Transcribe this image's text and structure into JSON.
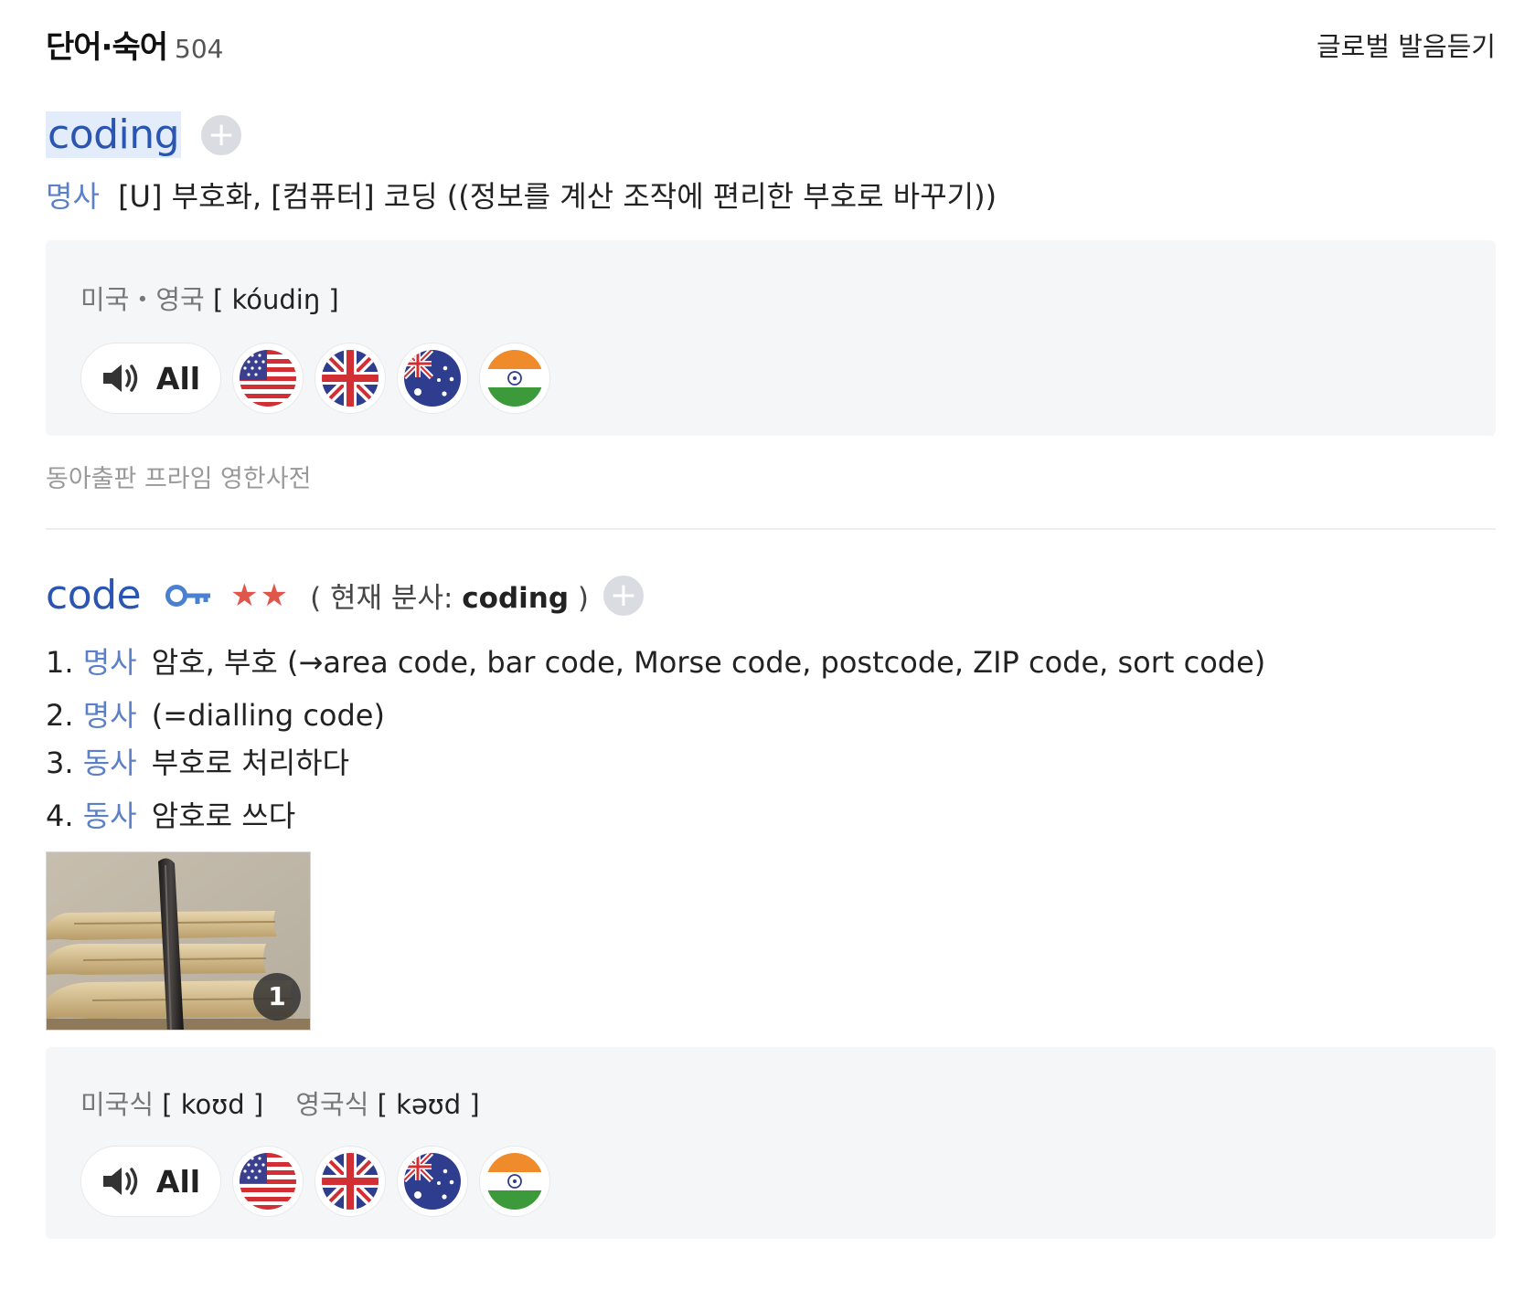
{
  "header": {
    "title": "단어·숙어",
    "count": "504",
    "global_link": "글로벌 발음듣기"
  },
  "entry1": {
    "headword": "coding",
    "pos": "명사",
    "definition": "[U] 부호화, [컴퓨터] 코딩 ((정보를 계산 조작에 편리한 부호로 바꾸기))",
    "pron_label": "미국・영국",
    "pron": "[ kóudiŋ ]",
    "all_label": "All",
    "source": "동아출판 프라임 영한사전"
  },
  "entry2": {
    "headword": "code",
    "stars": "★★",
    "participle_open": "( 현재 분사: ",
    "participle_word": "coding",
    "participle_close": " )",
    "meanings": [
      {
        "num": "1.",
        "pos": "명사",
        "text": "암호, 부호 (→area code, bar code, Morse code, postcode, ZIP code, sort code)"
      },
      {
        "num": "2.",
        "pos": "명사",
        "text": "(=dialling code)"
      },
      {
        "num": "3.",
        "pos": "동사",
        "text": "부호로 처리하다"
      },
      {
        "num": "4.",
        "pos": "동사",
        "text": "암호로 쓰다"
      }
    ],
    "image_count": "1",
    "pron_us_label": "미국식",
    "pron_us": "[ koʊd ]",
    "pron_uk_label": "영국식",
    "pron_uk": "[ kəʊd ]",
    "all_label": "All"
  },
  "icons": {
    "plus": "plus-icon",
    "speaker": "speaker-icon",
    "key": "key-icon",
    "flags": [
      "us-flag-icon",
      "uk-flag-icon",
      "au-flag-icon",
      "in-flag-icon"
    ]
  },
  "colors": {
    "headword": "#2a55b3",
    "pos": "#5b7fc9",
    "star": "#e0564a",
    "pron_bg": "#f5f6f7"
  }
}
